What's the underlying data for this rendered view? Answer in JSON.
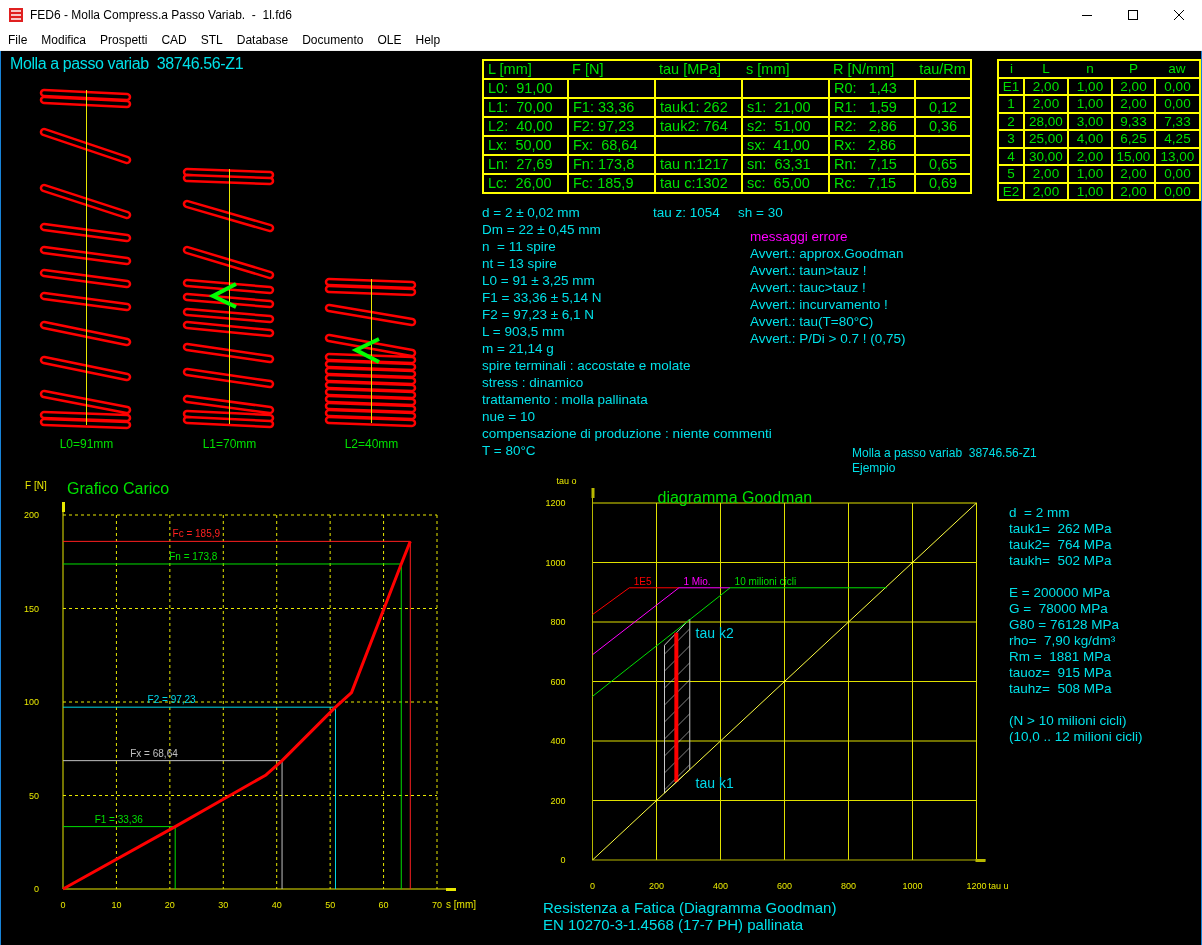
{
  "window": {
    "title": "FED6 - Molla Compress.a Passo Variab.  -  1l.fd6"
  },
  "menu": [
    "File",
    "Modifica",
    "Prospetti",
    "CAD",
    "STL",
    "Database",
    "Documento",
    "OLE",
    "Help"
  ],
  "heading": "Molla a passo variab  38746.56-Z1",
  "springs": [
    {
      "label": "L0=91mm"
    },
    {
      "label": "L1=70mm"
    },
    {
      "label": "L2=40mm"
    }
  ],
  "results_table": {
    "columns": [
      "L [mm]",
      "F [N]",
      "tau [MPa]",
      "s [mm]",
      "R [N/mm]",
      "tau/Rm"
    ],
    "rows": [
      [
        "L0:  91,00",
        null,
        null,
        null,
        "R0:   1,43",
        null
      ],
      [
        "L1:  70,00",
        "F1: 33,36",
        "tauk1: 262",
        "s1:  21,00",
        "R1:   1,59",
        "0,12"
      ],
      [
        "L2:  40,00",
        "F2: 97,23",
        "tauk2: 764",
        "s2:  51,00",
        "R2:   2,86",
        "0,36"
      ],
      [
        "Lx:  50,00",
        "Fx:  68,64",
        null,
        "sx:  41,00",
        "Rx:   2,86",
        null
      ],
      [
        "Ln:  27,69",
        "Fn: 173,8",
        "tau n:1217",
        "sn:  63,31",
        "Rn:   7,15",
        "0,65"
      ],
      [
        "Lc:  26,00",
        "Fc: 185,9",
        "tau c:1302",
        "sc:  65,00",
        "Rc:   7,15",
        "0,69"
      ]
    ]
  },
  "tau_z": "tau z: 1054",
  "sh": "sh = 30",
  "properties": [
    "d = 2 ± 0,02 mm",
    "Dm = 22 ± 0,45 mm",
    "n  = 11 spire",
    "nt = 13 spire",
    "L0 = 91 ± 3,25 mm",
    "F1 = 33,36 ± 5,14 N",
    "F2 = 97,23 ± 6,1 N",
    "L = 903,5 mm",
    "m = 21,14 g",
    "spire terminali : accostate e molate",
    "stress : dinamico",
    "trattamento : molla pallinata",
    "nue = 10",
    "compensazione di produzione : niente commenti",
    "T = 80°C"
  ],
  "messages": {
    "title": "messaggi errore",
    "items": [
      "Avvert.: approx.Goodman",
      "Avvert.: taun>tauz !",
      "Avvert.: tauc>tauz !",
      "Avvert.: incurvamento !",
      "Avvert.: tau(T=80°C)",
      "Avvert.: P/Di > 0.7 ! (0,75)"
    ]
  },
  "caption": [
    "Molla a passo variab  38746.56-Z1",
    "Ejempio"
  ],
  "pitch_table": {
    "columns": [
      "i",
      "L",
      "n",
      "P",
      "aw"
    ],
    "rows": [
      [
        "E1",
        "2,00",
        "1,00",
        "2,00",
        "0,00"
      ],
      [
        "1",
        "2,00",
        "1,00",
        "2,00",
        "0,00"
      ],
      [
        "2",
        "28,00",
        "3,00",
        "9,33",
        "7,33"
      ],
      [
        "3",
        "25,00",
        "4,00",
        "6,25",
        "4,25"
      ],
      [
        "4",
        "30,00",
        "2,00",
        "15,00",
        "13,00"
      ],
      [
        "5",
        "2,00",
        "1,00",
        "2,00",
        "0,00"
      ],
      [
        "E2",
        "2,00",
        "1,00",
        "2,00",
        "0,00"
      ]
    ]
  },
  "load_chart": {
    "chart_data": {
      "type": "line",
      "title": "Grafico Carico",
      "xlabel": "s [mm]",
      "ylabel": "F [N]",
      "x": [
        0,
        21,
        38,
        41,
        51,
        54,
        63.31,
        65
      ],
      "series": [
        {
          "color": "#ff0000",
          "values": [
            0,
            33.36,
            61,
            68.64,
            97.23,
            105,
            173.8,
            185.9
          ]
        }
      ],
      "ref_lines": [
        {
          "axis": "y",
          "value": 33.36,
          "label": "F1 = 33,36",
          "color": "#00e000"
        },
        {
          "axis": "x",
          "value": 21,
          "color": "#00e000"
        },
        {
          "axis": "y",
          "value": 68.64,
          "label": "Fx = 68,64",
          "color": "#c0c0c0"
        },
        {
          "axis": "x",
          "value": 41,
          "color": "#c0c0c0"
        },
        {
          "axis": "y",
          "value": 97.23,
          "label": "F2 = 97,23",
          "color": "#00d8e8"
        },
        {
          "axis": "x",
          "value": 51,
          "color": "#00d8e8"
        },
        {
          "axis": "y",
          "value": 173.8,
          "label": "Fn = 173,8",
          "color": "#00e000"
        },
        {
          "axis": "x",
          "value": 63.31,
          "color": "#00e000"
        },
        {
          "axis": "y",
          "value": 185.9,
          "label": "Fc = 185,9",
          "color": "#ff2020"
        },
        {
          "axis": "x",
          "value": 65,
          "color": "#ff2020"
        }
      ],
      "xlim": [
        0,
        70
      ],
      "ylim": [
        0,
        200
      ],
      "xticks": [
        0,
        10,
        20,
        30,
        40,
        50,
        60,
        70
      ],
      "yticks": [
        0,
        50,
        100,
        150,
        200
      ],
      "grid": true
    }
  },
  "goodman": {
    "chart_data": {
      "type": "line",
      "title": "diagramma Goodman",
      "xlabel": "tau u",
      "ylabel": "tau o",
      "x": [
        0,
        115,
        270,
        430,
        920,
        1200
      ],
      "series": [
        {
          "color": "#ffff40",
          "values": [
            0,
            115,
            270,
            430,
            920,
            1200
          ]
        },
        {
          "name": "1E5",
          "color": "#ff0000",
          "values": [
            825,
            915,
            915,
            null,
            null,
            null
          ]
        },
        {
          "name": "1 Mio.",
          "color": "#ff00ff",
          "values": [
            690,
            786,
            915,
            915,
            null,
            null
          ]
        },
        {
          "name": "10 milioni cicli",
          "color": "#00e000",
          "values": [
            550,
            648,
            779,
            915,
            915,
            null
          ]
        }
      ],
      "xlim": [
        0,
        1200
      ],
      "ylim": [
        0,
        1200
      ],
      "xticks": [
        0,
        200,
        400,
        600,
        800,
        1000,
        1200
      ],
      "yticks": [
        0,
        200,
        400,
        600,
        800,
        1000,
        1200
      ],
      "grid": true,
      "annotations": [
        "tau k2",
        "tau k1"
      ]
    },
    "info": [
      [
        "d  = 2 mm",
        "tauk1=  262 MPa",
        "tauk2=  764 MPa",
        "taukh=  502 MPa"
      ],
      [
        "E = 200000 MPa",
        "G =  78000 MPa",
        "G80 = 76128 MPa",
        "rho=  7,90 kg/dm³",
        "Rm =  1881 MPa",
        "tauoz=  915 MPa",
        "tauhz=  508 MPa"
      ],
      [
        "(N > 10 milioni cicli)",
        "(10,0 .. 12 milioni cicli)"
      ]
    ],
    "footer": [
      "Resistenza a Fatica (Diagramma Goodman)",
      "EN 10270-3-1.4568 (17-7 PH) pallinata"
    ]
  }
}
